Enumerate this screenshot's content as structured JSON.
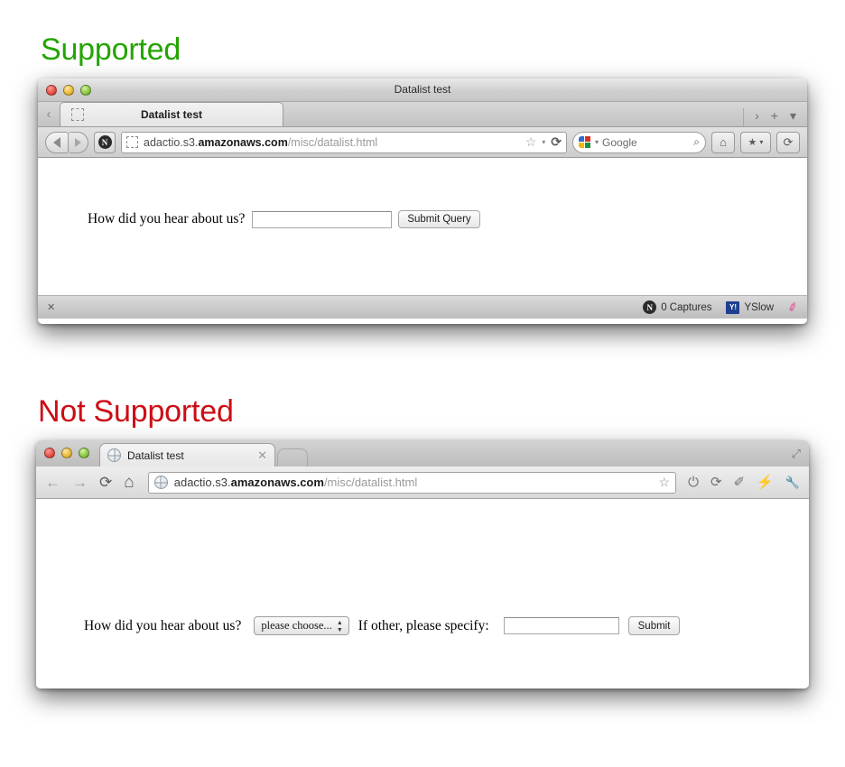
{
  "headings": {
    "supported": "Supported",
    "not_supported": "Not Supported",
    "supported_color": "#24a400",
    "not_supported_color": "#cc0d15"
  },
  "firefox_window": {
    "title": "Datalist test",
    "tab": {
      "label": "Datalist test",
      "favicon": "broken-image-icon"
    },
    "tabstrip_right": {
      "list_all_tabs": "›",
      "new_tab": "+",
      "menu": "▾"
    },
    "toolbar": {
      "back": "back-arrow-icon",
      "forward": "forward-arrow-icon",
      "evernote_badge": "N",
      "url_favicon": "broken-image-icon",
      "url_prefix": "adactio.s3.",
      "url_domain": "amazonaws.com",
      "url_path": "/misc/datalist.html",
      "star": "☆",
      "star_caret": "▾",
      "reload": "⟳",
      "search_engine": "google-logo-icon",
      "search_caret": "▾",
      "search_placeholder": "Google",
      "search_magnifier": "⌕",
      "home": "⌂",
      "bookmarks": "★",
      "bookmarks_caret": "▾",
      "sync": "⟳"
    },
    "page": {
      "question_label": "How did you hear about us?",
      "input_value": "",
      "input_placeholder": "",
      "submit_label": "Submit Query"
    },
    "statusbar": {
      "close": "✕",
      "captures": "0 Captures",
      "captures_icon": "N",
      "yslow": "YSlow",
      "yslow_icon": "Y!",
      "broom_icon": "✐"
    }
  },
  "chrome_window": {
    "tab": {
      "label": "Datalist test",
      "favicon": "globe-icon",
      "close": "✕"
    },
    "new_tab_button": "new-tab-button",
    "fullscreen": "⤢",
    "toolbar": {
      "back": "←",
      "forward": "→",
      "reload": "⟳",
      "home": "⌂",
      "url_favicon": "globe-icon",
      "url_prefix": "adactio.s3.",
      "url_domain": "amazonaws.com",
      "url_path": "/misc/datalist.html",
      "star": "☆",
      "ext_power": "⏻",
      "ext_sync": "⟳",
      "ext_highlighter": "✐",
      "ext_bolt": "⚡",
      "ext_wrench": "🔧"
    },
    "page": {
      "question_label": "How did you hear about us?",
      "select_value": "please choose...",
      "select_options": [
        "please choose..."
      ],
      "other_label": "If other, please specify:",
      "input_value": "",
      "input_placeholder": "",
      "submit_label": "Submit"
    }
  }
}
